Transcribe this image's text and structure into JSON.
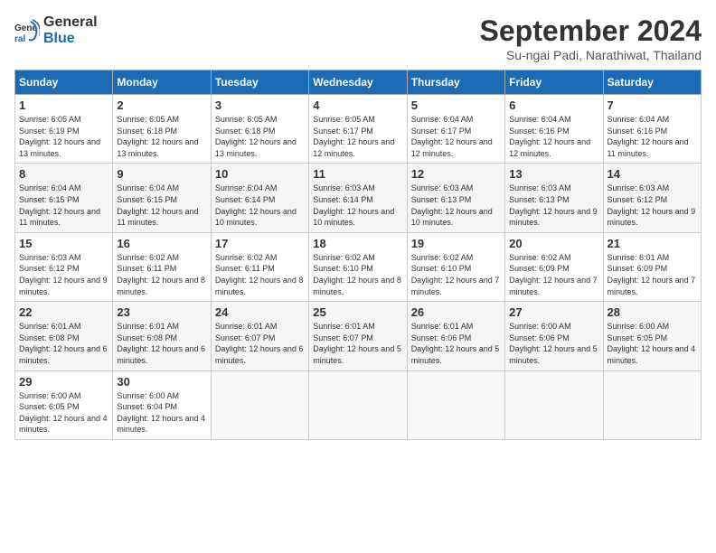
{
  "header": {
    "logo_line1": "General",
    "logo_line2": "Blue",
    "month": "September 2024",
    "location": "Su-ngai Padi, Narathiwat, Thailand"
  },
  "days_of_week": [
    "Sunday",
    "Monday",
    "Tuesday",
    "Wednesday",
    "Thursday",
    "Friday",
    "Saturday"
  ],
  "weeks": [
    [
      {
        "day": "1",
        "sunrise": "6:05 AM",
        "sunset": "6:19 PM",
        "daylight": "12 hours and 13 minutes."
      },
      {
        "day": "2",
        "sunrise": "6:05 AM",
        "sunset": "6:18 PM",
        "daylight": "12 hours and 13 minutes."
      },
      {
        "day": "3",
        "sunrise": "6:05 AM",
        "sunset": "6:18 PM",
        "daylight": "12 hours and 13 minutes."
      },
      {
        "day": "4",
        "sunrise": "6:05 AM",
        "sunset": "6:17 PM",
        "daylight": "12 hours and 12 minutes."
      },
      {
        "day": "5",
        "sunrise": "6:04 AM",
        "sunset": "6:17 PM",
        "daylight": "12 hours and 12 minutes."
      },
      {
        "day": "6",
        "sunrise": "6:04 AM",
        "sunset": "6:16 PM",
        "daylight": "12 hours and 12 minutes."
      },
      {
        "day": "7",
        "sunrise": "6:04 AM",
        "sunset": "6:16 PM",
        "daylight": "12 hours and 11 minutes."
      }
    ],
    [
      {
        "day": "8",
        "sunrise": "6:04 AM",
        "sunset": "6:15 PM",
        "daylight": "12 hours and 11 minutes."
      },
      {
        "day": "9",
        "sunrise": "6:04 AM",
        "sunset": "6:15 PM",
        "daylight": "12 hours and 11 minutes."
      },
      {
        "day": "10",
        "sunrise": "6:04 AM",
        "sunset": "6:14 PM",
        "daylight": "12 hours and 10 minutes."
      },
      {
        "day": "11",
        "sunrise": "6:03 AM",
        "sunset": "6:14 PM",
        "daylight": "12 hours and 10 minutes."
      },
      {
        "day": "12",
        "sunrise": "6:03 AM",
        "sunset": "6:13 PM",
        "daylight": "12 hours and 10 minutes."
      },
      {
        "day": "13",
        "sunrise": "6:03 AM",
        "sunset": "6:13 PM",
        "daylight": "12 hours and 9 minutes."
      },
      {
        "day": "14",
        "sunrise": "6:03 AM",
        "sunset": "6:12 PM",
        "daylight": "12 hours and 9 minutes."
      }
    ],
    [
      {
        "day": "15",
        "sunrise": "6:03 AM",
        "sunset": "6:12 PM",
        "daylight": "12 hours and 9 minutes."
      },
      {
        "day": "16",
        "sunrise": "6:02 AM",
        "sunset": "6:11 PM",
        "daylight": "12 hours and 8 minutes."
      },
      {
        "day": "17",
        "sunrise": "6:02 AM",
        "sunset": "6:11 PM",
        "daylight": "12 hours and 8 minutes."
      },
      {
        "day": "18",
        "sunrise": "6:02 AM",
        "sunset": "6:10 PM",
        "daylight": "12 hours and 8 minutes."
      },
      {
        "day": "19",
        "sunrise": "6:02 AM",
        "sunset": "6:10 PM",
        "daylight": "12 hours and 7 minutes."
      },
      {
        "day": "20",
        "sunrise": "6:02 AM",
        "sunset": "6:09 PM",
        "daylight": "12 hours and 7 minutes."
      },
      {
        "day": "21",
        "sunrise": "6:01 AM",
        "sunset": "6:09 PM",
        "daylight": "12 hours and 7 minutes."
      }
    ],
    [
      {
        "day": "22",
        "sunrise": "6:01 AM",
        "sunset": "6:08 PM",
        "daylight": "12 hours and 6 minutes."
      },
      {
        "day": "23",
        "sunrise": "6:01 AM",
        "sunset": "6:08 PM",
        "daylight": "12 hours and 6 minutes."
      },
      {
        "day": "24",
        "sunrise": "6:01 AM",
        "sunset": "6:07 PM",
        "daylight": "12 hours and 6 minutes."
      },
      {
        "day": "25",
        "sunrise": "6:01 AM",
        "sunset": "6:07 PM",
        "daylight": "12 hours and 5 minutes."
      },
      {
        "day": "26",
        "sunrise": "6:01 AM",
        "sunset": "6:06 PM",
        "daylight": "12 hours and 5 minutes."
      },
      {
        "day": "27",
        "sunrise": "6:00 AM",
        "sunset": "6:06 PM",
        "daylight": "12 hours and 5 minutes."
      },
      {
        "day": "28",
        "sunrise": "6:00 AM",
        "sunset": "6:05 PM",
        "daylight": "12 hours and 4 minutes."
      }
    ],
    [
      {
        "day": "29",
        "sunrise": "6:00 AM",
        "sunset": "6:05 PM",
        "daylight": "12 hours and 4 minutes."
      },
      {
        "day": "30",
        "sunrise": "6:00 AM",
        "sunset": "6:04 PM",
        "daylight": "12 hours and 4 minutes."
      },
      null,
      null,
      null,
      null,
      null
    ]
  ]
}
